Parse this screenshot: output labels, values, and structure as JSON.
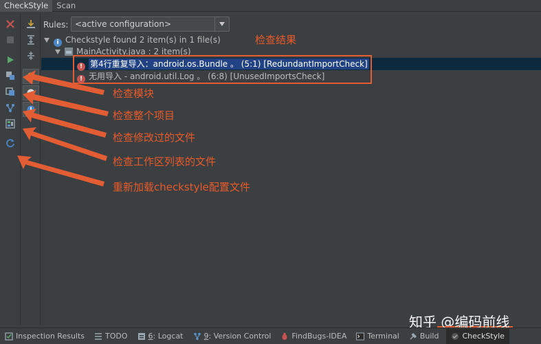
{
  "tabs": {
    "checkstyle": "CheckStyle",
    "scan": "Scan"
  },
  "rules": {
    "label": "Rules:",
    "value": "<active configuration>"
  },
  "tree": {
    "root": "Checkstyle found 2 item(s) in 1 file(s)",
    "file": "MainActivity.java : 2 item(s)",
    "items": [
      "第4行重复导入：android.os.Bundle 。 (5:1) [RedundantImportCheck]",
      "无用导入 - android.util.Log 。 (6:8) [UnusedImportsCheck]"
    ]
  },
  "annotations": {
    "result": "检查结果",
    "module": "检查模块",
    "project": "检查整个项目",
    "modified": "检查修改过的文件",
    "changelist": "检查工作区列表的文件",
    "reload": "重新加载checkstyle配置文件"
  },
  "bottom": {
    "inspection": "Inspection Results",
    "todo": "TODO",
    "logcat_num": "6",
    "logcat_rest": ": Logcat",
    "vc_num": "9",
    "vc_rest": ": Version Control",
    "findbugs": "FindBugs-IDEA",
    "terminal": "Terminal",
    "build": "Build",
    "checkstyle": "CheckStyle"
  },
  "watermark": "知乎 @编码前线",
  "colors": {
    "annotation": "#e85a2a",
    "selection": "#214283",
    "error": "#c75450",
    "info": "#4b86c8",
    "run": "#59a869",
    "close": "#c75450"
  }
}
